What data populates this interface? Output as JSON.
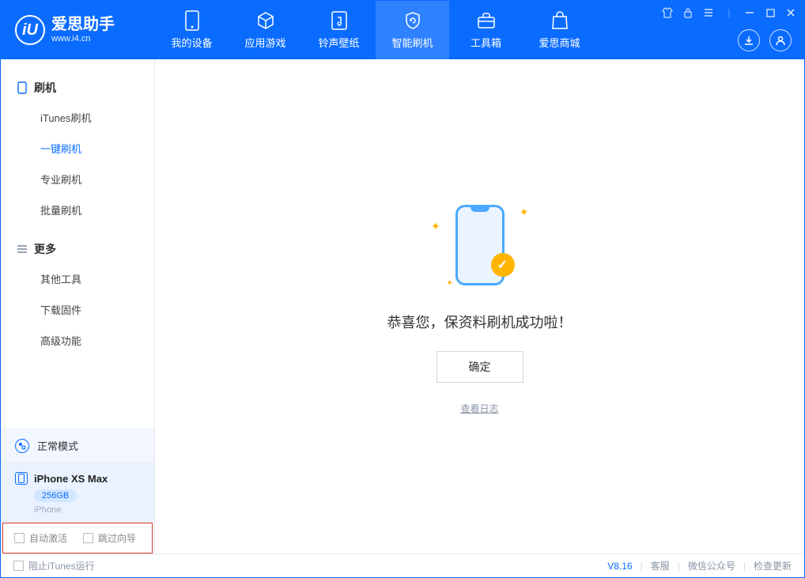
{
  "app": {
    "title": "爱思助手",
    "subtitle": "www.i4.cn"
  },
  "nav": {
    "tabs": [
      {
        "label": "我的设备"
      },
      {
        "label": "应用游戏"
      },
      {
        "label": "铃声壁纸"
      },
      {
        "label": "智能刷机"
      },
      {
        "label": "工具箱"
      },
      {
        "label": "爱思商城"
      }
    ]
  },
  "sidebar": {
    "groups": [
      {
        "title": "刷机",
        "items": [
          {
            "label": "iTunes刷机"
          },
          {
            "label": "一键刷机",
            "active": true
          },
          {
            "label": "专业刷机"
          },
          {
            "label": "批量刷机"
          }
        ]
      },
      {
        "title": "更多",
        "items": [
          {
            "label": "其他工具"
          },
          {
            "label": "下载固件"
          },
          {
            "label": "高级功能"
          }
        ]
      }
    ],
    "mode": "正常模式",
    "device": {
      "name": "iPhone XS Max",
      "storage": "256GB",
      "type": "iPhone"
    },
    "checks": {
      "auto_activate": "自动激活",
      "skip_wizard": "跳过向导"
    }
  },
  "main": {
    "success": "恭喜您，保资料刷机成功啦！",
    "ok": "确定",
    "log": "查看日志"
  },
  "footer": {
    "block_itunes": "阻止iTunes运行",
    "version": "V8.16",
    "links": {
      "support": "客服",
      "wechat": "微信公众号",
      "update": "检查更新"
    }
  }
}
